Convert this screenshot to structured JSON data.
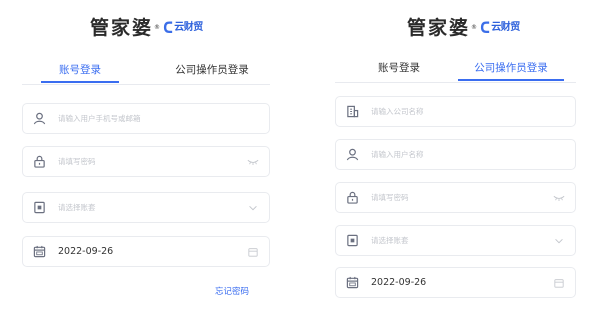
{
  "logo": {
    "main": "管家婆",
    "reg_mark": "®",
    "brand_text": "云财贸"
  },
  "left_form": {
    "tabs": [
      {
        "label": "账号登录",
        "active": true
      },
      {
        "label": "公司操作员登录",
        "active": false
      }
    ],
    "fields": {
      "account_placeholder": "请输入用户手机号或邮箱",
      "password_placeholder": "请填写密码",
      "ledger_placeholder": "请选择账套",
      "date_value": "2022-09-26"
    },
    "forgot_password": "忘记密码"
  },
  "right_form": {
    "tabs": [
      {
        "label": "账号登录",
        "active": false
      },
      {
        "label": "公司操作员登录",
        "active": true
      }
    ],
    "fields": {
      "company_placeholder": "请输入公司名称",
      "username_placeholder": "请输入用户名称",
      "password_placeholder": "请填写密码",
      "ledger_placeholder": "请选择账套",
      "date_value": "2022-09-26"
    }
  },
  "colors": {
    "accent": "#3a6df0",
    "placeholder": "#c3c6cc",
    "border": "#e9ebef",
    "icon": "#6b7080"
  },
  "icons": [
    "user-icon",
    "lock-icon",
    "ledger-icon",
    "calendar-icon",
    "building-icon",
    "eye-closed-icon",
    "chevron-down-icon"
  ]
}
